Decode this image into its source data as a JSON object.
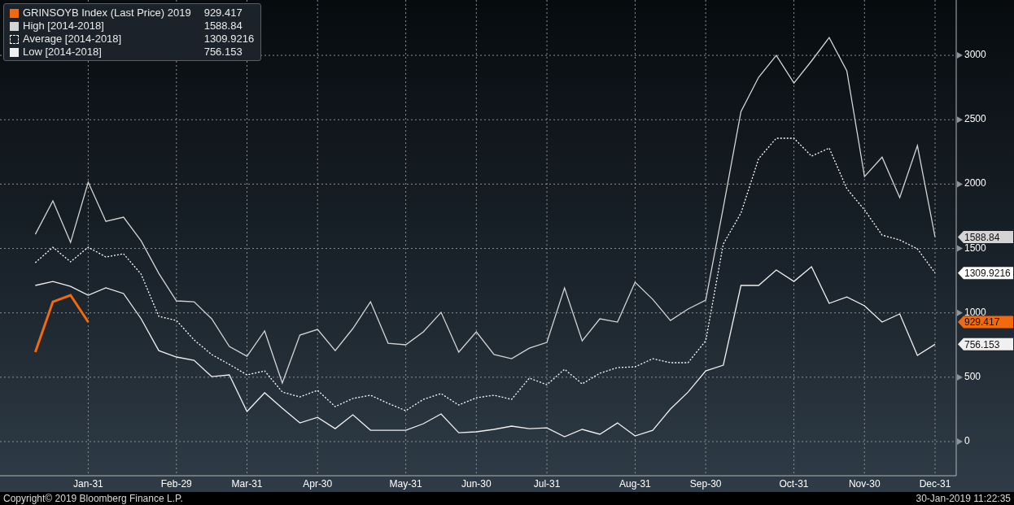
{
  "chart": {
    "legend": [
      {
        "value": "929.417"
      },
      {
        "value": "1588.84"
      },
      {
        "value": "1309.9216"
      },
      {
        "value": "756.153"
      }
    ],
    "value_tags": [
      {
        "text": "1588.84",
        "color": "#d4d4d4"
      },
      {
        "text": "1309.9216",
        "color": "#ffffff"
      },
      {
        "text": "929.417",
        "color": "#f26a0d"
      },
      {
        "text": "756.153",
        "color": "#f0f0f0"
      }
    ],
    "chart_data": {
      "type": "line",
      "categories": [
        null,
        null,
        null,
        "Jan-31",
        null,
        null,
        null,
        null,
        "Feb-29",
        null,
        null,
        null,
        "Mar-31",
        null,
        null,
        null,
        "Apr-30",
        null,
        null,
        null,
        null,
        "May-31",
        null,
        null,
        null,
        "Jun-30",
        null,
        null,
        null,
        "Jul-31",
        null,
        null,
        null,
        null,
        "Aug-31",
        null,
        null,
        null,
        "Sep-30",
        null,
        null,
        null,
        null,
        "Oct-31",
        null,
        null,
        null,
        "Nov-30",
        null,
        null,
        null,
        "Dec-31"
      ],
      "ylim": [
        -265,
        3430
      ],
      "grid": true,
      "yticks": [
        0,
        500,
        1000,
        1500,
        2000,
        2500,
        3000
      ],
      "series": [
        {
          "name": "GRINSOYB Index (Last Price) 2019",
          "color": "#f26a0d",
          "line_style": "solid",
          "values": [
            695,
            1086,
            1137,
            929,
            null,
            null,
            null,
            null,
            null,
            null,
            null,
            null,
            null,
            null,
            null,
            null,
            null,
            null,
            null,
            null,
            null,
            null,
            null,
            null,
            null,
            null,
            null,
            null,
            null,
            null,
            null,
            null,
            null,
            null,
            null,
            null,
            null,
            null,
            null,
            null,
            null,
            null,
            null,
            null,
            null,
            null,
            null,
            null,
            null,
            null,
            null,
            null
          ]
        },
        {
          "name": "High [2014-2018]",
          "color": "#d4d4d4",
          "line_style": "solid",
          "values": [
            1610,
            1870,
            1547,
            2015,
            1711,
            1743,
            1560,
            1307,
            1093,
            1086,
            954,
            739,
            663,
            859,
            455,
            827,
            871,
            707,
            878,
            1086,
            764,
            752,
            853,
            1004,
            695,
            853,
            676,
            644,
            726,
            771,
            1194,
            783,
            954,
            928,
            1238,
            1105,
            941,
            1030,
            1099,
            1819,
            2564,
            2830,
            3000,
            2785,
            2956,
            3139,
            2880,
            2059,
            2210,
            1895,
            2299,
            1589
          ]
        },
        {
          "name": "Average [2014-2018]",
          "color": "#ffffff",
          "line_style": "dotted",
          "values": [
            1390,
            1510,
            1396,
            1510,
            1434,
            1459,
            1301,
            973,
            941,
            790,
            676,
            600,
            518,
            549,
            385,
            347,
            398,
            272,
            335,
            360,
            297,
            240,
            328,
            373,
            284,
            341,
            360,
            328,
            493,
            442,
            562,
            448,
            531,
            575,
            581,
            644,
            613,
            613,
            783,
            1535,
            1775,
            2198,
            2356,
            2356,
            2217,
            2280,
            1964,
            1800,
            1604,
            1566,
            1497,
            1310
          ]
        },
        {
          "name": "Low [2014-2018]",
          "color": "#f0f0f0",
          "line_style": "solid",
          "values": [
            1213,
            1244,
            1206,
            1137,
            1194,
            1150,
            954,
            707,
            657,
            632,
            505,
            518,
            234,
            379,
            259,
            145,
            189,
            101,
            208,
            88,
            88,
            88,
            139,
            215,
            69,
            76,
            95,
            120,
            101,
            107,
            38,
            95,
            57,
            145,
            44,
            88,
            253,
            385,
            549,
            594,
            1213,
            1213,
            1333,
            1244,
            1358,
            1074,
            1124,
            1055,
            928,
            992,
            670,
            756
          ]
        }
      ]
    }
  },
  "footer": {
    "copyright": "Copyright© 2019 Bloomberg Finance L.P.",
    "timestamp": "30-Jan-2019 11:22:35"
  }
}
